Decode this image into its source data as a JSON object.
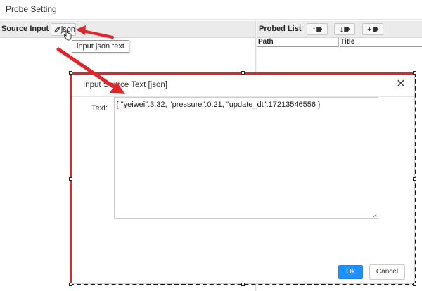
{
  "window": {
    "title": "Probe Setting"
  },
  "source_panel": {
    "label": "Source Input",
    "json_button_label": "json",
    "tooltip": "input json text"
  },
  "probed_panel": {
    "label": "Probed List",
    "buttons": [
      {
        "glyph": "↑",
        "icon": "tag-icon"
      },
      {
        "glyph": "↓",
        "icon": "tag-icon"
      },
      {
        "glyph": "+",
        "icon": "tag-icon"
      }
    ],
    "columns": [
      "Path",
      "Title"
    ]
  },
  "dialog": {
    "title": "Input Source Text [json]",
    "close_glyph": "✕",
    "field_label": "Text:",
    "text_value": "{ \"yeiwei\":3.32, \"pressure\":0.21, \"update_dt\":17213546556 }",
    "ok_label": "Ok",
    "cancel_label": "Cancel"
  },
  "colors": {
    "accent": "#1e90ff",
    "annotation_red": "#e0252b"
  }
}
